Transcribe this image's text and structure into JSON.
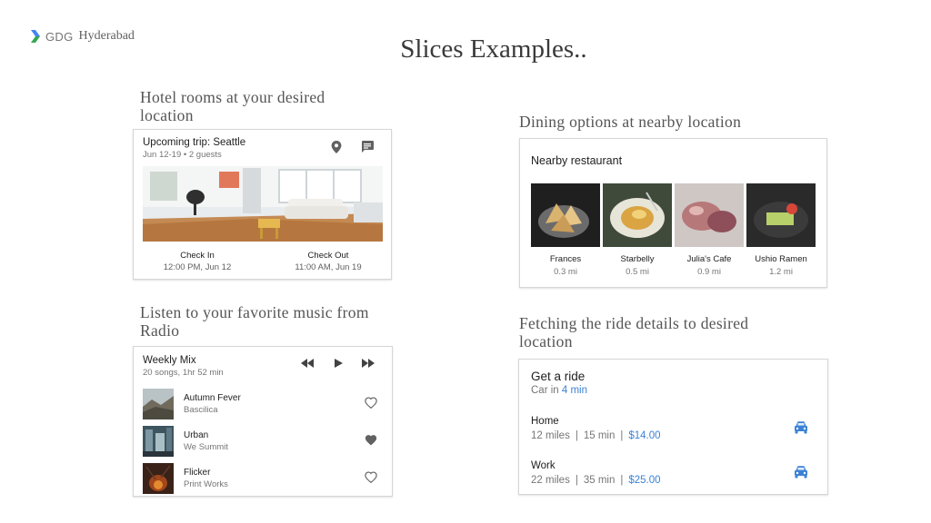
{
  "header": {
    "brand_gdg": "GDG",
    "brand_city": "Hyderabad",
    "title": "Slices Examples.."
  },
  "captions": {
    "hotel_line1": "Hotel rooms at your desired",
    "hotel_line2": "location",
    "dining": "Dining options at nearby location",
    "music_line1": "Listen to your favorite music from",
    "music_line2": "Radio",
    "ride_line1": "Fetching the ride details to desired",
    "ride_line2": "location"
  },
  "hotel": {
    "title": "Upcoming trip: Seattle",
    "subtitle": "Jun 12-19 • 2 guests",
    "icons": [
      "location-pin-icon",
      "message-icon"
    ],
    "check_in_label": "Check In",
    "check_in_value": "12:00 PM, Jun 12",
    "check_out_label": "Check Out",
    "check_out_value": "11:00 AM, Jun 19"
  },
  "music": {
    "title": "Weekly Mix",
    "subtitle": "20 songs, 1hr 52 min",
    "controls": [
      "rewind-icon",
      "play-icon",
      "fast-forward-icon"
    ],
    "songs": [
      {
        "name": "Autumn Fever",
        "artist": "Bascilica",
        "favorite": false
      },
      {
        "name": "Urban",
        "artist": "We Summit",
        "favorite": true
      },
      {
        "name": "Flicker",
        "artist": "Print Works",
        "favorite": false
      }
    ]
  },
  "dining": {
    "title": "Nearby restaurant",
    "restaurants": [
      {
        "name": "Frances",
        "distance": "0.3 mi"
      },
      {
        "name": "Starbelly",
        "distance": "0.5 mi"
      },
      {
        "name": "Julia's Cafe",
        "distance": "0.9 mi"
      },
      {
        "name": "Ushio Ramen",
        "distance": "1.2 mi"
      }
    ]
  },
  "ride": {
    "title": "Get a ride",
    "subtitle_prefix": "Car in",
    "eta": "4 min",
    "destinations": [
      {
        "name": "Home",
        "miles": "12 miles",
        "time": "15 min",
        "price": "$14.00"
      },
      {
        "name": "Work",
        "miles": "22 miles",
        "time": "35 min",
        "price": "$25.00"
      }
    ],
    "separator": "|"
  },
  "colors": {
    "accent_blue": "#3b82d6",
    "heart": "#616161",
    "icon_gray": "#616161"
  }
}
